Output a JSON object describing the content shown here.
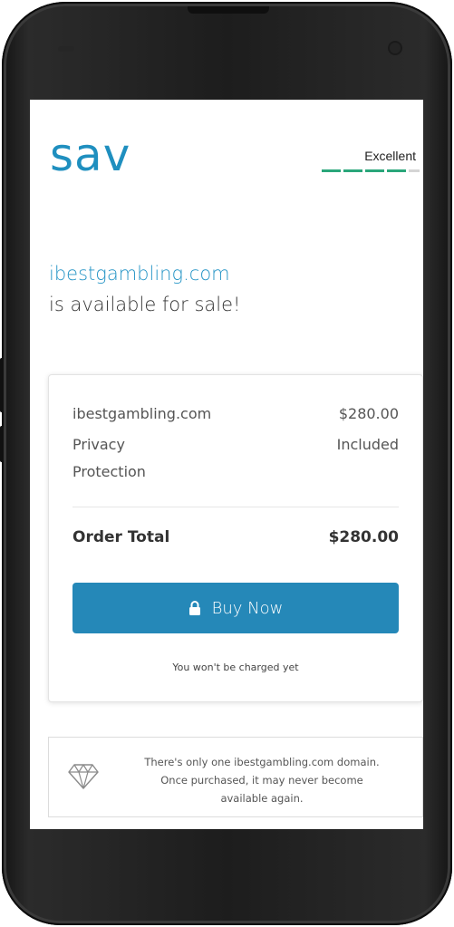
{
  "header": {
    "logo_text": "sav",
    "rating_label": "Excellent",
    "rating_filled": 4,
    "rating_total": 5
  },
  "hero": {
    "domain": "ibestgambling.com",
    "subtitle": "is available for sale!"
  },
  "order": {
    "items": [
      {
        "label": "ibestgambling.com",
        "value": "$280.00"
      },
      {
        "label_line1": "Privacy",
        "label_line2": "Protection",
        "value": "Included"
      }
    ],
    "total_label": "Order Total",
    "total_value": "$280.00",
    "buy_label": "Buy Now",
    "charge_note": "You won't be charged yet"
  },
  "notice": {
    "line1": "There's only one ibestgambling.com domain.",
    "line2": "Once purchased, it may never become",
    "line3": "available again."
  },
  "colors": {
    "brand": "#1f8fbf",
    "button": "#2588b8",
    "rating": "#2aa67a"
  },
  "icons": {
    "buy": "lock-icon",
    "notice": "diamond-icon"
  }
}
